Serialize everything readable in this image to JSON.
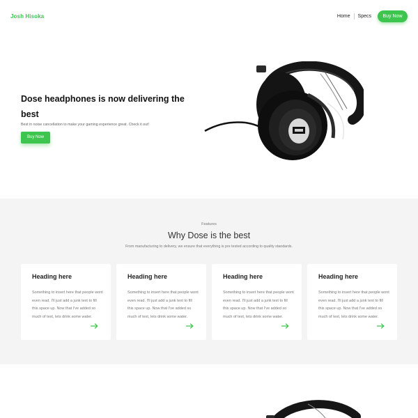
{
  "nav": {
    "brand": "Josh Hisoka",
    "links": [
      "Home",
      "Specs"
    ],
    "cta": "Buy Now"
  },
  "hero": {
    "title": "Dose headphones is now delivering the best",
    "subtitle": "Best in noise cancellation to make your gaming experience great. Check it out!",
    "cta": "Buy Now",
    "image_icon": "headphones-icon"
  },
  "features": {
    "eyebrow": "Features",
    "title": "Why Dose is the best",
    "subtitle": "From manufacturing to delivery, we ensure that everything is pre tested according to quality standards.",
    "cards": [
      {
        "heading": "Heading here",
        "body": "Something to insert here that people wont even read. I'll just add a junk text to fill this space up. Now that I've added so much of text, lets drink some water."
      },
      {
        "heading": "Heading here",
        "body": "Something to insert here that people wont even read. I'll just add a junk text to fill this space up. Now that I've added so much of text, lets drink some water."
      },
      {
        "heading": "Heading here",
        "body": "Something to insert here that people wont even read. I'll just add a junk text to fill this space up. Now that I've added so much of text, lets drink some water."
      },
      {
        "heading": "Heading here",
        "body": "Something to insert here that people wont even read. I'll just add a junk text to fill this space up. Now that I've added so much of text, lets drink some water."
      }
    ]
  },
  "colors": {
    "accent": "#3ec54f",
    "section_bg": "#f4f4f4"
  }
}
